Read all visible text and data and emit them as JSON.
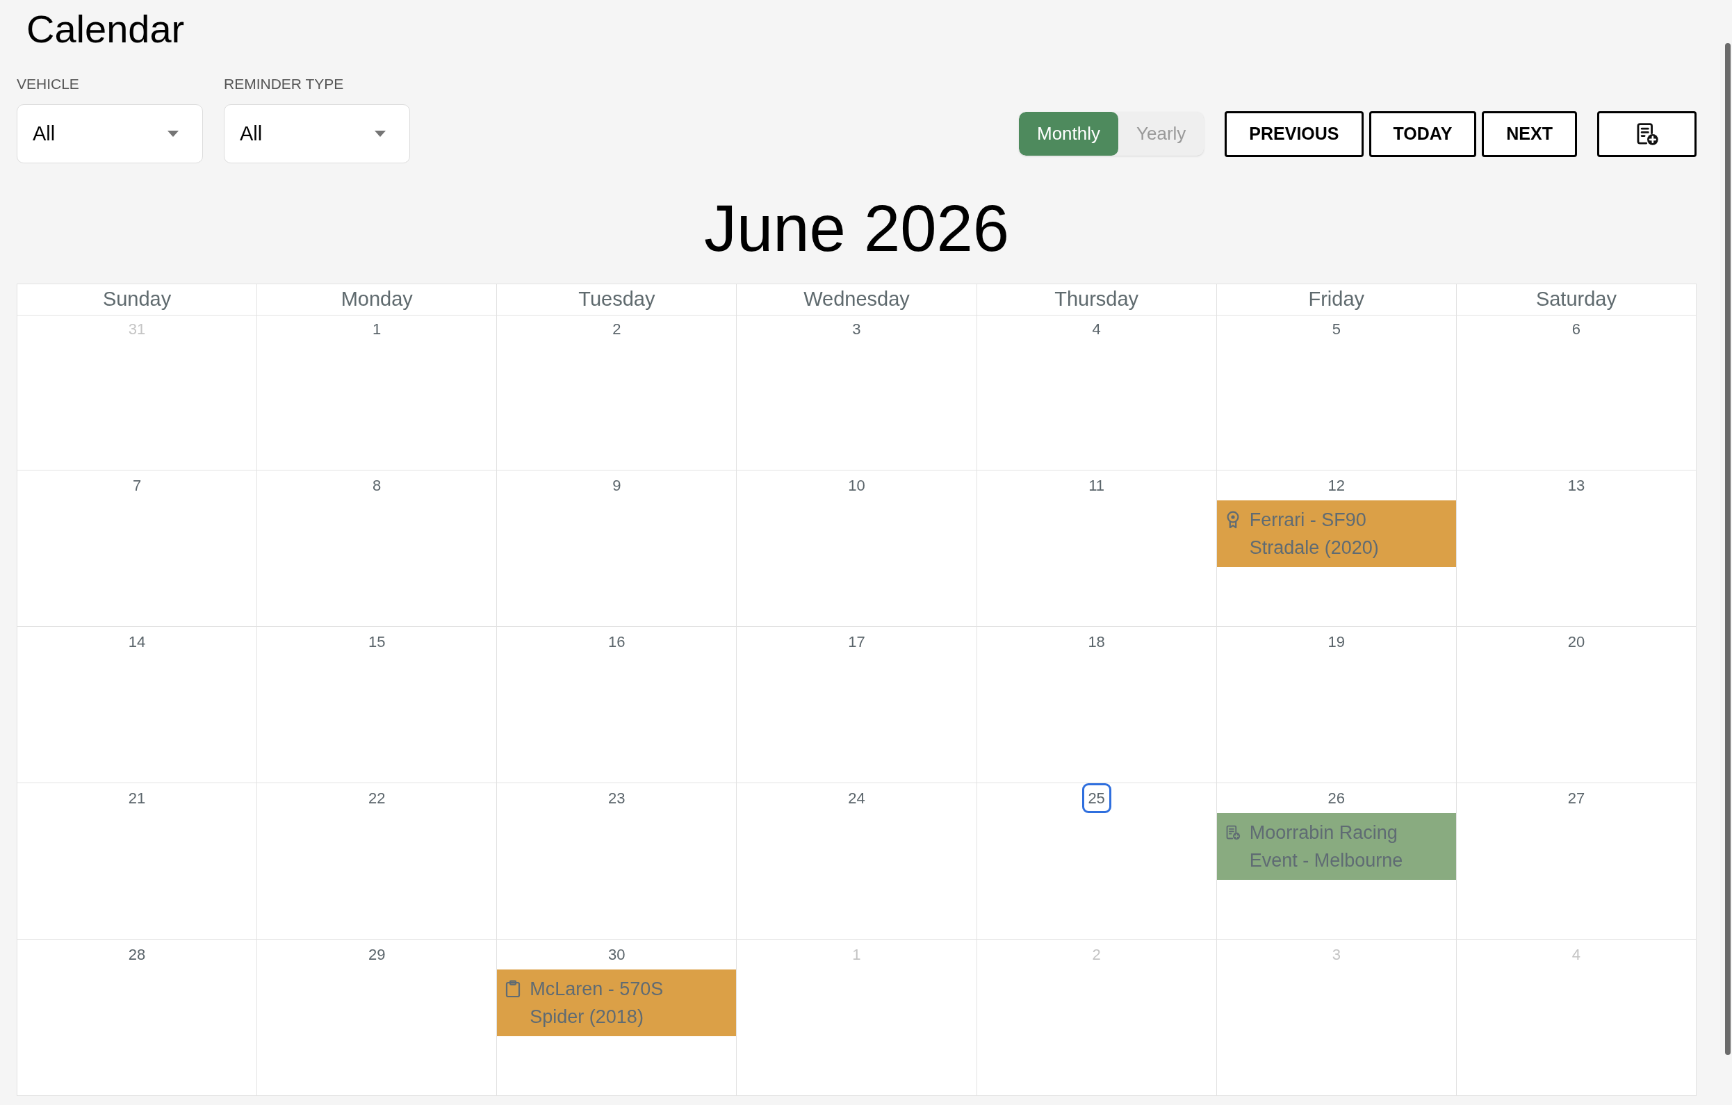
{
  "page": {
    "title": "Calendar"
  },
  "filters": [
    {
      "label": "VEHICLE",
      "value": "All"
    },
    {
      "label": "REMINDER TYPE",
      "value": "All"
    }
  ],
  "view_toggle": [
    {
      "label": "Monthly",
      "selected": true
    },
    {
      "label": "Yearly",
      "selected": false
    }
  ],
  "nav_buttons": [
    "PREVIOUS",
    "TODAY",
    "NEXT"
  ],
  "calendar": {
    "title": "June 2026",
    "weekdays": [
      "Sunday",
      "Monday",
      "Tuesday",
      "Wednesday",
      "Thursday",
      "Friday",
      "Saturday"
    ],
    "weeks": [
      [
        {
          "day": "31",
          "in_month": false,
          "today": false
        },
        {
          "day": "1",
          "in_month": true,
          "today": false
        },
        {
          "day": "2",
          "in_month": true,
          "today": false
        },
        {
          "day": "3",
          "in_month": true,
          "today": false
        },
        {
          "day": "4",
          "in_month": true,
          "today": false
        },
        {
          "day": "5",
          "in_month": true,
          "today": false
        },
        {
          "day": "6",
          "in_month": true,
          "today": false
        }
      ],
      [
        {
          "day": "7",
          "in_month": true,
          "today": false
        },
        {
          "day": "8",
          "in_month": true,
          "today": false
        },
        {
          "day": "9",
          "in_month": true,
          "today": false
        },
        {
          "day": "10",
          "in_month": true,
          "today": false
        },
        {
          "day": "11",
          "in_month": true,
          "today": false
        },
        {
          "day": "12",
          "in_month": true,
          "today": false,
          "events": [
            {
              "title": "Ferrari - SF90 Stradale (2020)",
              "kind": "award",
              "color": "#dba047"
            }
          ]
        },
        {
          "day": "13",
          "in_month": true,
          "today": false
        }
      ],
      [
        {
          "day": "14",
          "in_month": true,
          "today": false
        },
        {
          "day": "15",
          "in_month": true,
          "today": false
        },
        {
          "day": "16",
          "in_month": true,
          "today": false
        },
        {
          "day": "17",
          "in_month": true,
          "today": false
        },
        {
          "day": "18",
          "in_month": true,
          "today": false
        },
        {
          "day": "19",
          "in_month": true,
          "today": false
        },
        {
          "day": "20",
          "in_month": true,
          "today": false
        }
      ],
      [
        {
          "day": "21",
          "in_month": true,
          "today": false
        },
        {
          "day": "22",
          "in_month": true,
          "today": false
        },
        {
          "day": "23",
          "in_month": true,
          "today": false
        },
        {
          "day": "24",
          "in_month": true,
          "today": false
        },
        {
          "day": "25",
          "in_month": true,
          "today": true
        },
        {
          "day": "26",
          "in_month": true,
          "today": false,
          "events": [
            {
              "title": "Moorrabin Racing Event - Melbourne",
              "kind": "document",
              "color": "#89ab80"
            }
          ]
        },
        {
          "day": "27",
          "in_month": true,
          "today": false
        }
      ],
      [
        {
          "day": "28",
          "in_month": true,
          "today": false
        },
        {
          "day": "29",
          "in_month": true,
          "today": false
        },
        {
          "day": "30",
          "in_month": true,
          "today": false,
          "events": [
            {
              "title": "McLaren - 570S Spider (2018)",
              "kind": "clipboard",
              "color": "#dba047"
            }
          ]
        },
        {
          "day": "1",
          "in_month": false,
          "today": false
        },
        {
          "day": "2",
          "in_month": false,
          "today": false
        },
        {
          "day": "3",
          "in_month": false,
          "today": false
        },
        {
          "day": "4",
          "in_month": false,
          "today": false
        }
      ]
    ]
  }
}
